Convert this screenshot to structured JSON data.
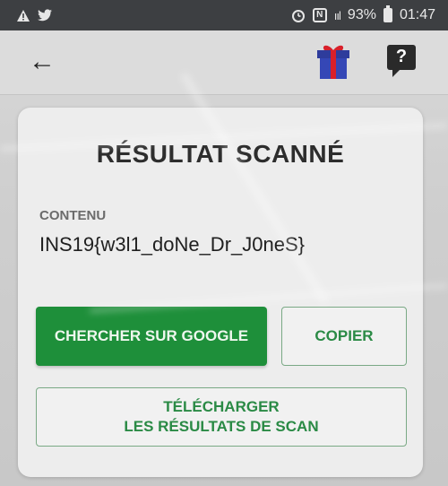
{
  "status_bar": {
    "left_icons": [
      "warning-icon",
      "twitter-icon"
    ],
    "battery_percent": "93%",
    "time": "01:47",
    "right_icons": [
      "alarm-icon",
      "nfc-icon",
      "signal-icon",
      "battery-icon"
    ],
    "nfc_glyph": "N",
    "signal_glyph": "ııl"
  },
  "app_bar": {
    "back_glyph": "←",
    "help_glyph": "?"
  },
  "card": {
    "title": "RÉSULTAT SCANNÉ",
    "content_label": "CONTENU",
    "content_value": "INS19{w3l1_doNe_Dr_J0neS}",
    "google_button": "CHERCHER SUR GOOGLE",
    "copy_button": "COPIER",
    "download_line1": "TÉLÉCHARGER",
    "download_line2": "LES RÉSULTATS DE SCAN"
  },
  "colors": {
    "primary_green": "#1e8f3a",
    "outline_green": "#2a8a45",
    "status_bar": "#3d3f42"
  }
}
